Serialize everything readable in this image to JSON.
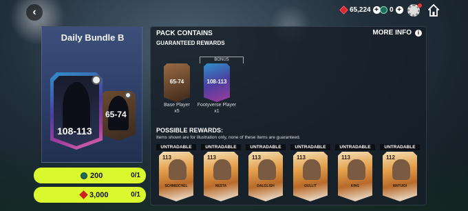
{
  "topbar": {
    "gems": "65,224",
    "coins": "0"
  },
  "bundle": {
    "title": "Daily Bundle B",
    "big_rating": "108-113",
    "small_rating": "65-74"
  },
  "purchase": [
    {
      "price": "200",
      "count": "0/1",
      "currency_icon": "coin-icon"
    },
    {
      "price": "3,000",
      "count": "0/1",
      "currency_icon": "gem-icon"
    }
  ],
  "pack": {
    "heading": "PACK CONTAINS",
    "more_info": "MORE INFO",
    "guaranteed_heading": "GUARANTEED REWARDS",
    "bonus_label": "BONUS",
    "guaranteed": [
      {
        "rating": "65-74",
        "name": "Base Player",
        "qty": "x5"
      },
      {
        "rating": "108-113",
        "name": "Footyverse Player",
        "qty": "x1"
      }
    ],
    "possible_heading": "POSSIBLE REWARDS:",
    "disclaimer": "Items shown are for illustration only, none of these items are guaranteed.",
    "possible": [
      {
        "tag": "UNTRADABLE",
        "rating": "113",
        "name": "SCHMEICHEL"
      },
      {
        "tag": "UNTRADABLE",
        "rating": "113",
        "name": "NESTA"
      },
      {
        "tag": "UNTRADABLE",
        "rating": "113",
        "name": "DALGLISH"
      },
      {
        "tag": "UNTRADABLE",
        "rating": "113",
        "name": "GULLIT"
      },
      {
        "tag": "UNTRADABLE",
        "rating": "113",
        "name": "KING"
      },
      {
        "tag": "UNTRADABLE",
        "rating": "112",
        "name": "MATUIDI"
      }
    ]
  }
}
